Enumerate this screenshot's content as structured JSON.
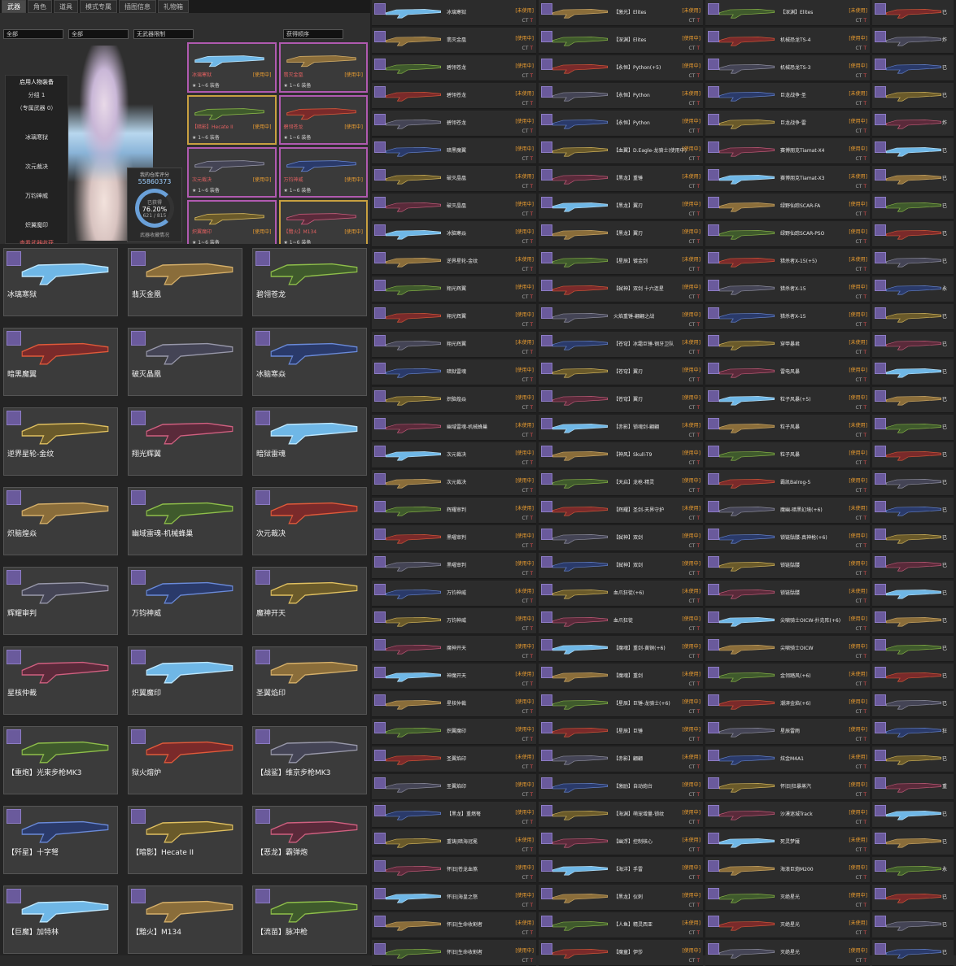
{
  "tabs": [
    "武器",
    "角色",
    "道具",
    "模式专属",
    "插图信息",
    "礼物箱"
  ],
  "filters": [
    "全部",
    "全部",
    "无武器限制",
    "获得顺序"
  ],
  "side_panel": {
    "title": "启用人物装备",
    "group_label": "分组 1",
    "sub_label": "（专属武器 0）",
    "items": [
      "冰璃寒狱",
      "次元裁决",
      "万钧神威",
      "炽翼魔印"
    ],
    "footer": "查看武器收获"
  },
  "score": {
    "title": "我的仓库评分",
    "value": "55860373",
    "ring_label": "已获得",
    "percent": "76.20%",
    "fraction": "621 / 815",
    "footer": "武器收藏情况"
  },
  "featured": [
    {
      "name": "冰璃寒狱",
      "tag": "[使用中]",
      "foot": "★ 1~6",
      "action": "装备",
      "style": "pink"
    },
    {
      "name": "翡灭金凰",
      "tag": "[使用中]",
      "foot": "★ 1~6",
      "action": "装备",
      "style": "pink"
    },
    {
      "name": "【暗影】Hecate II",
      "tag": "[使用中]",
      "foot": "★ 1~6",
      "action": "装备",
      "style": "gold"
    },
    {
      "name": "碧翎苍龙",
      "tag": "[使用中]",
      "foot": "★ 1~6",
      "action": "装备",
      "style": "pink"
    },
    {
      "name": "次元裁决",
      "tag": "[使用中]",
      "foot": "★ 1~6",
      "action": "装备",
      "style": "pink"
    },
    {
      "name": "万钧神威",
      "tag": "[使用中]",
      "foot": "★ 1~6",
      "action": "装备",
      "style": "pink"
    },
    {
      "name": "炽翼魔印",
      "tag": "[使用中]",
      "foot": "★ 1~6",
      "action": "装备",
      "style": "pink"
    },
    {
      "name": "【黯火】M134",
      "tag": "[使用中]",
      "foot": "★ 1~6",
      "action": "装备",
      "style": "gold"
    }
  ],
  "left_cards": [
    "冰璃寒狱",
    "翡灭金凰",
    "碧翎苍龙",
    "暗黑魔翼",
    "破灭晶凰",
    "冰脑寒焱",
    "逆界星轮-金纹",
    "翔光辉翼",
    "暗狱雷魂",
    "炽脑煌焱",
    "幽域雷魂-机械蜂巢",
    "次元裁决",
    "辉耀审判",
    "万钧神威",
    "魔神开天",
    "星核仲裁",
    "炽翼魔印",
    "圣翼焰印",
    "【重炮】光束步枪MK3",
    "狱火熔炉",
    "【战鲨】维京步枪MK3",
    "【歼星】十字弩",
    "【暗影】Hecate II",
    "【恶龙】霸弹炮",
    "【巨魔】加特林",
    "【黯火】M134",
    "【流苗】脉冲枪"
  ],
  "list_cols": [
    [
      "冰璃寒狱",
      "翡灭金凰",
      "碧翎苍龙",
      "碧翎苍龙",
      "碧翎苍龙",
      "暗黑魔翼",
      "破灭晶凰",
      "破灭晶凰",
      "冰脑寒焱",
      "逆界星轮-金纹",
      "翔光辉翼",
      "翔光辉翼",
      "翔光辉翼",
      "暗狱雷魂",
      "炽脑煌焱",
      "幽域雷魂-机械蜂巢",
      "次元裁决",
      "次元裁决",
      "辉耀审判",
      "黑曜审判",
      "黑曜审判",
      "万钧神威",
      "万钧神威",
      "魔神开天",
      "神魔开天",
      "星核仲裁",
      "炽翼魔印",
      "圣翼焰印",
      "圣翼焰印",
      "【黑龙】重燃弩",
      "重铸|暗海冠冕",
      "怀旧|苍龙血煞",
      "怀旧|海皇之怒",
      "怀旧|生命收割者",
      "怀旧|生命收割者"
    ],
    [
      "【激光】Elites",
      "【深渊】Elites",
      "【永恒】Python(+5)",
      "【永恒】Python",
      "【永恒】Python",
      "【血翼】D.Eagle-龙骑士(使用中)",
      "【黑龙】重锤",
      "【黑龙】翼刃",
      "【黑龙】翼刃",
      "【星辰】镀金剑",
      "【弑神】双剑 十六连星",
      "火焰重锤-翩翩之战",
      "【苍穹】冰霜巨锤-钢牙卫队",
      "【苍穹】翼刃",
      "【苍穹】翼刃",
      "【赤影】锁魂剑-翩翩",
      "【神风】Skull-T9",
      "【天启】龙枪-精灵",
      "【辉耀】圣剑-天界守护",
      "【弑神】双剑",
      "【弑神】双剑",
      "血爪狂徒(+6)",
      "血爪狂徒",
      "【魔魂】重剑-黄铜(+6)",
      "【魔魂】重剑",
      "【星辰】巨锤-龙骑士(+6)",
      "【星辰】巨锤",
      "【赤影】翩翩",
      "【激励】自动炮台",
      "【海渊】萌宠增量-锁纹",
      "【幽浮】控制核心",
      "【海洋】手雷",
      "【黑龙】仪刺",
      "【人鱼】精灵西亚",
      "【魔童】伊莎"
    ],
    [
      "【深渊】Elites",
      "机械恐龙TS-4",
      "机械恐龙TS-3",
      "巨龙战争·圣",
      "巨龙战争·雷",
      "赛博朋克Tiamat-X4",
      "赛博朋克Tiamat-X3",
      "绿野仙踪SCAR-FA",
      "绿野仙踪SCAR-PSO",
      "猎杀者X-15(+5)",
      "猎杀者X-15",
      "猎杀者X-15",
      "穿甲暴君",
      "雷电风暴",
      "粒子风暴(+5)",
      "粒子风暴",
      "粒子风暴",
      "霸凯Balrog-5",
      "魔幽-暗黑幻境(+6)",
      "锁链骷髅-真神枪(+6)",
      "锁链骷髅",
      "锁链骷髅",
      "尖啸骑士OICW-扑克阵(+6)",
      "尖啸骑士OICW",
      "金翎踏风(+6)",
      "潮湃金焰(+6)",
      "星辰雷雨",
      "炫金M4A1",
      "怀旧|狂暴蒸汽",
      "沙漠迷城Track",
      "死灵梦魇",
      "海浪巨炮M200",
      "灭绝星光",
      "灭绝星光",
      "灭绝星光"
    ],
    [
      "已",
      "炸",
      "已",
      "已",
      "炸",
      "已",
      "已",
      "已",
      "已",
      "已",
      "永",
      "已",
      "已",
      "已",
      "已",
      "已",
      "已",
      "已",
      "已",
      "已",
      "已",
      "已",
      "已",
      "已",
      "已",
      "已",
      "狂",
      "已",
      "重",
      "已",
      "已",
      "永",
      "已",
      "已",
      "已"
    ]
  ],
  "list_status_used": "[使用中]",
  "list_status_unused": "[未使用]",
  "ct_label": "CT",
  "t_label": "T"
}
